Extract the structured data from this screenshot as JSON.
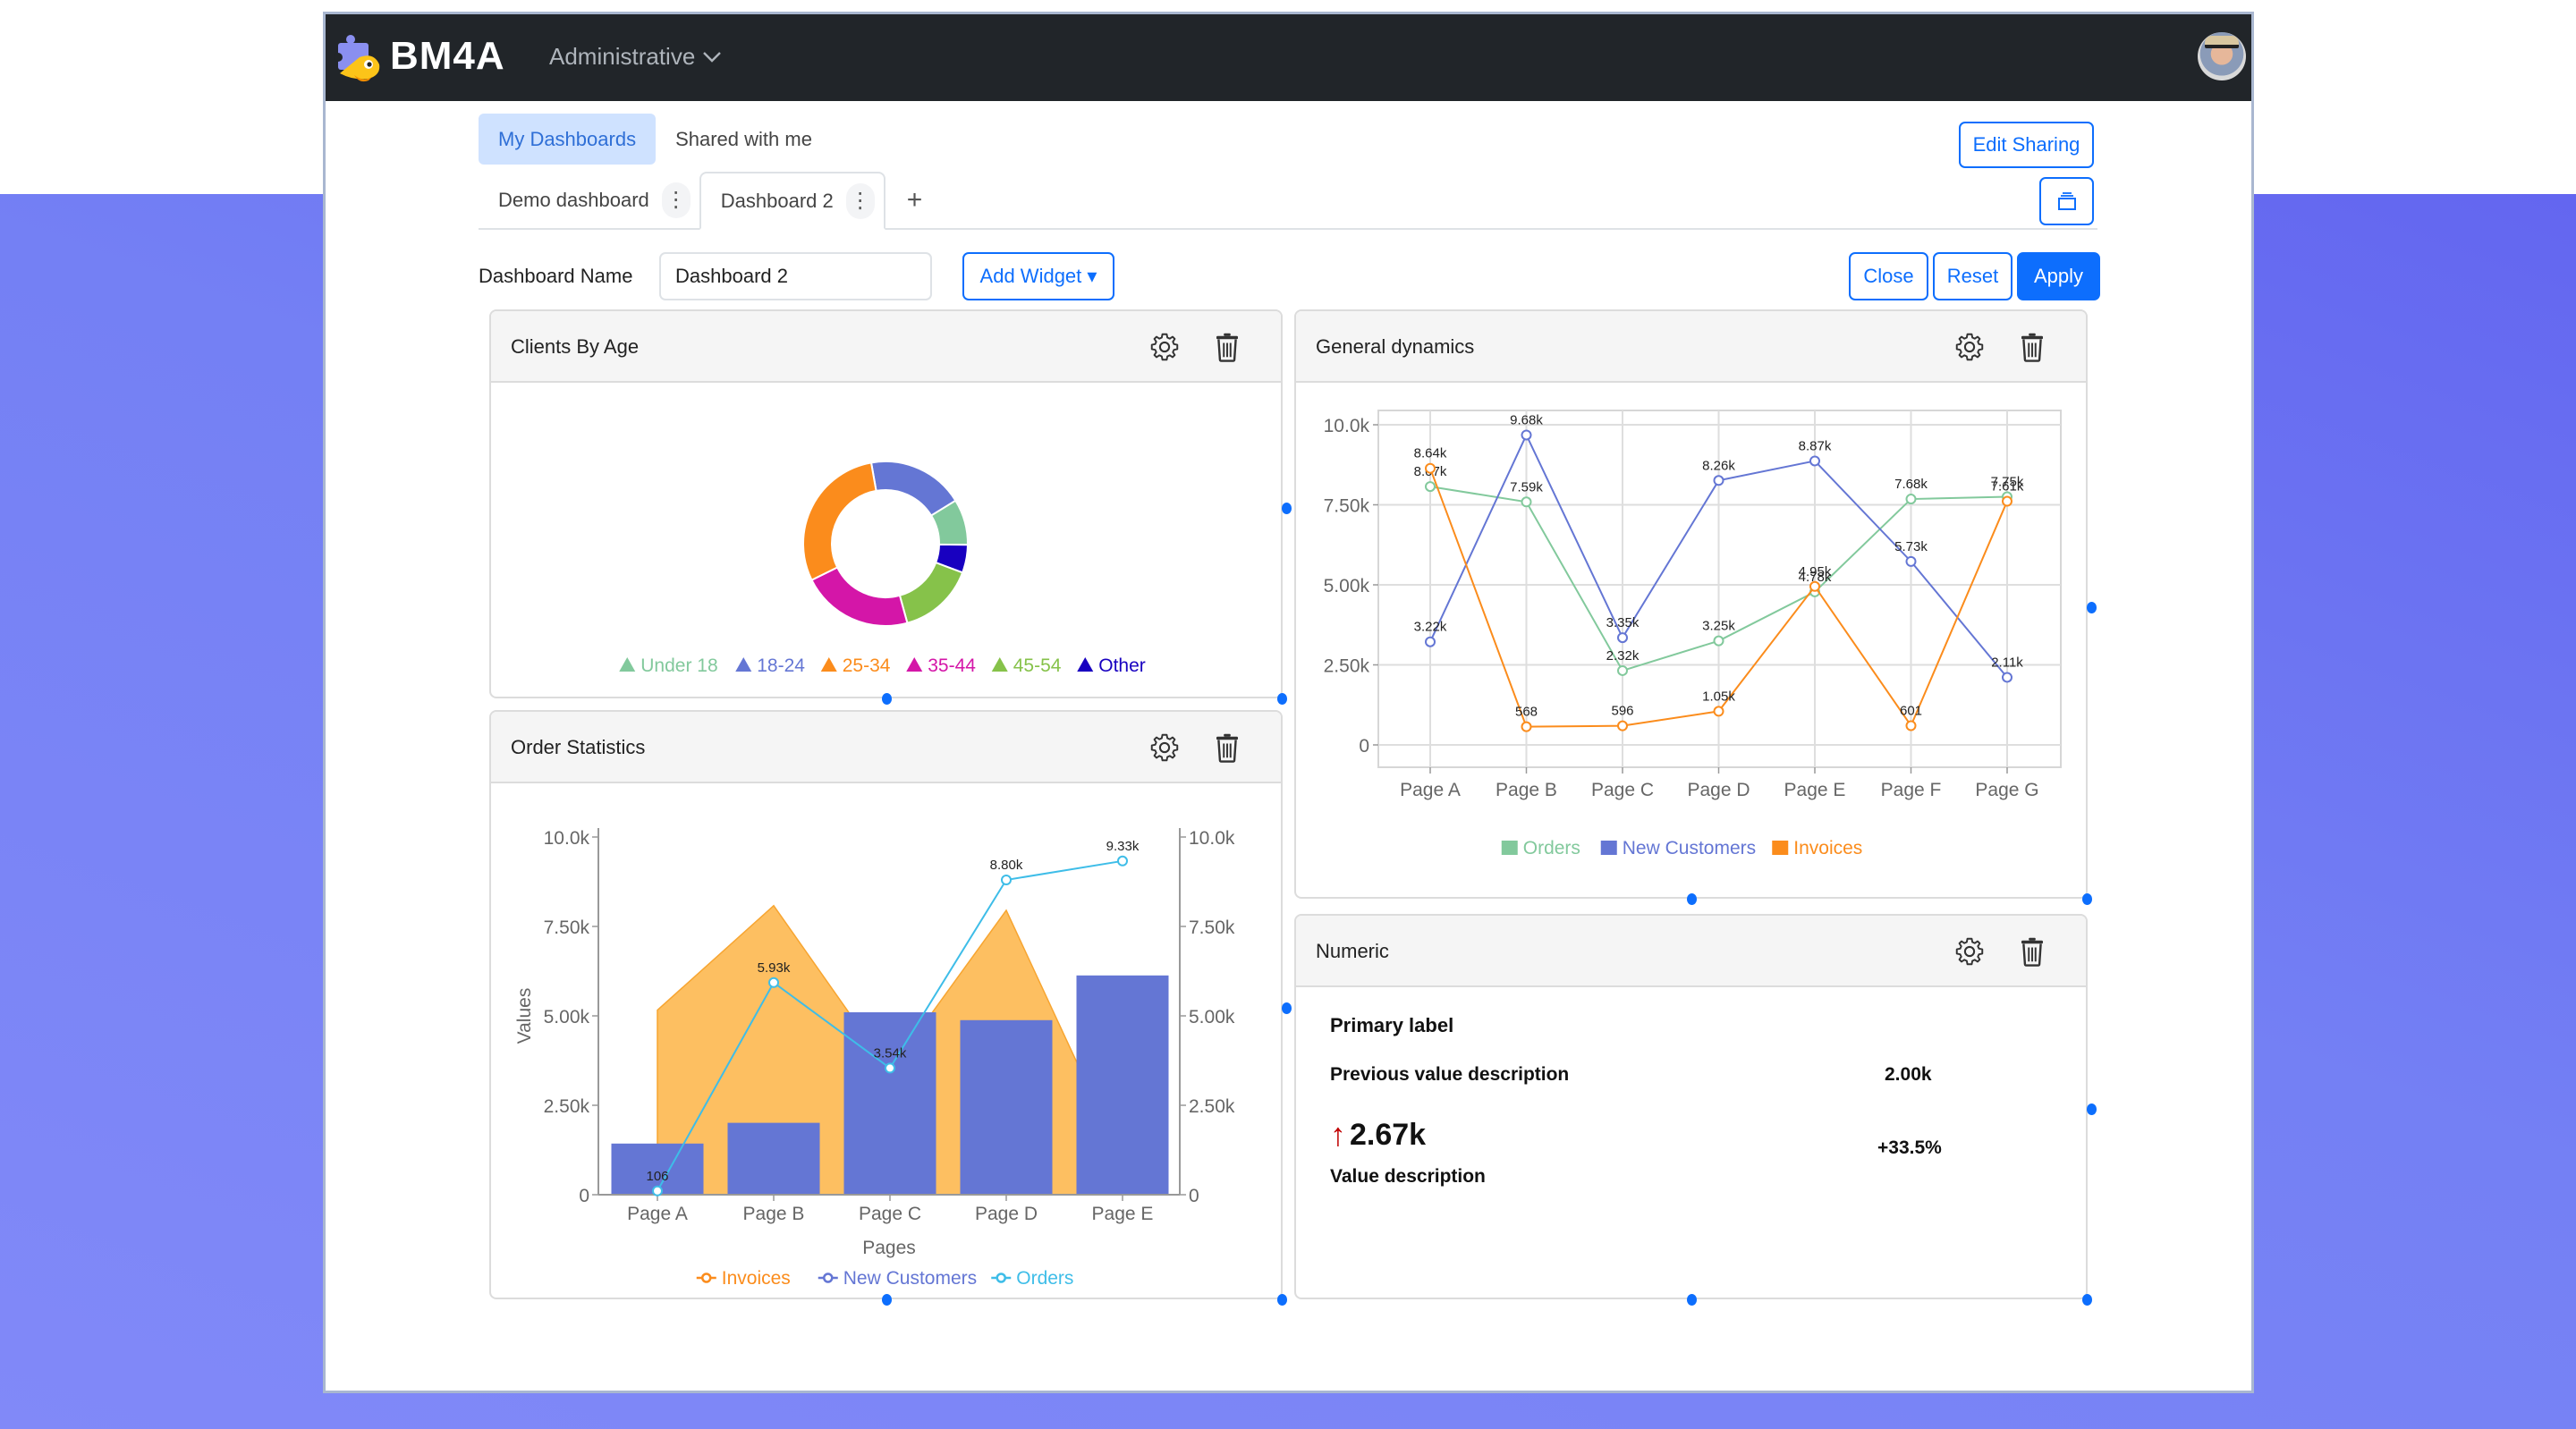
{
  "app": {
    "brand": "BM4A",
    "organization": "Administrative",
    "avatar_alt": "user avatar"
  },
  "dashboard_tabs": {
    "scope_tabs": [
      {
        "label": "My Dashboards",
        "active": true
      },
      {
        "label": "Shared with me",
        "active": false
      }
    ],
    "tabs": [
      {
        "label": "Demo dashboard",
        "active": false
      },
      {
        "label": "Dashboard 2",
        "active": true
      }
    ],
    "add_tab_label": "+",
    "kebab_label": "⋮"
  },
  "toolbar": {
    "edit_sharing_label": "Edit Sharing",
    "dashboard_name_label": "Dashboard Name",
    "dashboard_name_value": "Dashboard 2",
    "add_widget_label": "Add Widget ▾",
    "close_label": "Close",
    "reset_label": "Reset",
    "apply_label": "Apply"
  },
  "widgets": {
    "clients_by_age": {
      "title": "Clients By Age"
    },
    "general_dynamics": {
      "title": "General dynamics"
    },
    "order_statistics": {
      "title": "Order Statistics"
    },
    "numeric": {
      "title": "Numeric",
      "primary_label": "Primary label",
      "previous_value_description": "Previous value description",
      "previous_value": "2.00k",
      "trend_icon": "arrow-up",
      "value": "2.67k",
      "change": "+33.5%",
      "value_description": "Value description"
    }
  },
  "colors": {
    "primary": "#0d6efd",
    "orders_green": "#82c99c",
    "new_customers_blue": "#6476d4",
    "invoices_orange": "#fb8c1c",
    "area_orange": "#fdbf61",
    "orders_cyan": "#3ebde8"
  },
  "chart_data": [
    {
      "id": "clients_by_age",
      "type": "pie",
      "title": "Clients By Age",
      "donut": true,
      "legend_position": "bottom",
      "slices": [
        {
          "label": "18-24",
          "value": 19,
          "color": "#6476d4"
        },
        {
          "label": "Under 18",
          "value": 9,
          "color": "#82c99c"
        },
        {
          "label": "Other",
          "value": 5.5,
          "color": "#1800c0"
        },
        {
          "label": "45-54",
          "value": 15,
          "color": "#86c24a"
        },
        {
          "label": "35-44",
          "value": 22,
          "color": "#d416a8"
        },
        {
          "label": "25-34",
          "value": 29.5,
          "color": "#fb8c1c"
        }
      ],
      "legend": [
        {
          "label": "Under 18",
          "color": "#82c99c"
        },
        {
          "label": "18-24",
          "color": "#6476d4"
        },
        {
          "label": "25-34",
          "color": "#fb8c1c"
        },
        {
          "label": "35-44",
          "color": "#d416a8"
        },
        {
          "label": "45-54",
          "color": "#86c24a"
        },
        {
          "label": "Other",
          "color": "#1800c0"
        }
      ]
    },
    {
      "id": "general_dynamics",
      "type": "line",
      "title": "General dynamics",
      "categories": [
        "Page A",
        "Page B",
        "Page C",
        "Page D",
        "Page E",
        "Page F",
        "Page G"
      ],
      "ylim": [
        0,
        10000
      ],
      "yticks": [
        "0",
        "2.50k",
        "5.00k",
        "7.50k",
        "10.0k"
      ],
      "grid": true,
      "legend_position": "bottom",
      "series": [
        {
          "name": "Orders",
          "color": "#82c99c",
          "values": [
            8070,
            7590,
            2320,
            3250,
            4780,
            7680,
            7750
          ],
          "labels": [
            "8.07k",
            "7.59k",
            "2.32k",
            "3.25k",
            "4.78k",
            "7.68k",
            "7.75k"
          ]
        },
        {
          "name": "New Customers",
          "color": "#6476d4",
          "values": [
            3220,
            9680,
            3350,
            8260,
            8870,
            5730,
            2110
          ],
          "labels": [
            "3.22k",
            "9.68k",
            "3.35k",
            "8.26k",
            "8.87k",
            "5.73k",
            "2.11k"
          ]
        },
        {
          "name": "Invoices",
          "color": "#fb8c1c",
          "values": [
            8640,
            568,
            596,
            1050,
            4950,
            601,
            7610
          ],
          "labels": [
            "8.64k",
            "568",
            "596",
            "1.05k",
            "4.95k",
            "601",
            "7.61k"
          ]
        }
      ]
    },
    {
      "id": "order_statistics",
      "type": "bar",
      "title": "Order Statistics",
      "categories": [
        "Page A",
        "Page B",
        "Page C",
        "Page D",
        "Page E"
      ],
      "xlabel": "Pages",
      "ylabel": "Values",
      "ylim": [
        0,
        10000
      ],
      "yticks": [
        "0",
        "2.50k",
        "5.00k",
        "7.50k",
        "10.0k"
      ],
      "legend_position": "bottom",
      "series": [
        {
          "name": "Invoices",
          "kind": "area",
          "color": "#fdbf61",
          "values": [
            5160,
            8080,
            3460,
            7950,
            950
          ]
        },
        {
          "name": "New Customers",
          "kind": "bar",
          "color": "#6476d4",
          "values": [
            1430,
            2010,
            5100,
            4880,
            6130
          ]
        },
        {
          "name": "Orders",
          "kind": "line",
          "color": "#3ebde8",
          "values": [
            106,
            5930,
            3540,
            8800,
            9330
          ],
          "labels": [
            "106",
            "5.93k",
            "3.54k",
            "8.80k",
            "9.33k"
          ]
        }
      ],
      "legend": [
        {
          "label": "Invoices",
          "color": "#fb8c1c"
        },
        {
          "label": "New Customers",
          "color": "#6476d4"
        },
        {
          "label": "Orders",
          "color": "#3ebde8"
        }
      ]
    }
  ]
}
